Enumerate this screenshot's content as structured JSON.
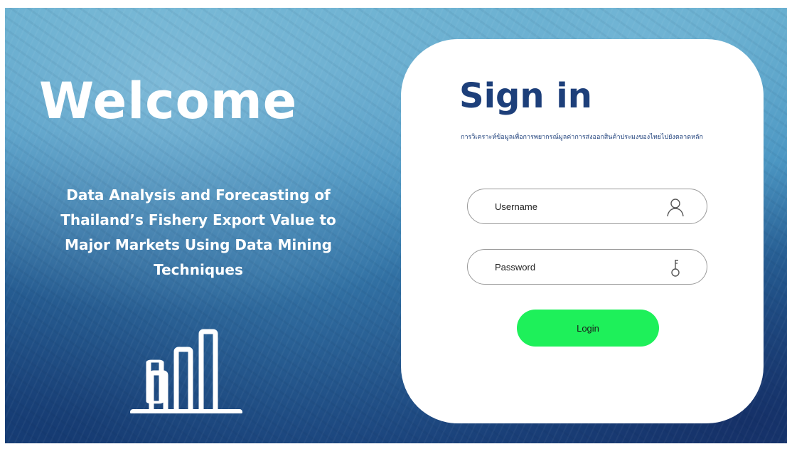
{
  "hero": {
    "welcome": "Welcome",
    "project_title": "Data Analysis and Forecasting of Thailand’s Fishery Export Value to Major Markets Using Data Mining Techniques",
    "icon": "bar-chart-icon"
  },
  "signin": {
    "title": "Sign in",
    "subtitle": "การวิเคราะห์ข้อมูลเพื่อการพยากรณ์มูลค่าการส่งออกสินค้าประมงของไทยไปยังตลาดหลัก",
    "username": {
      "placeholder": "Username",
      "value": "",
      "icon": "user-icon"
    },
    "password": {
      "placeholder": "Password",
      "value": "",
      "icon": "key-icon"
    },
    "login_label": "Login"
  },
  "colors": {
    "card_bg": "#ffffff",
    "title": "#1d3f7a",
    "login_button": "#1ef05a",
    "background": "#2c6fa5"
  }
}
